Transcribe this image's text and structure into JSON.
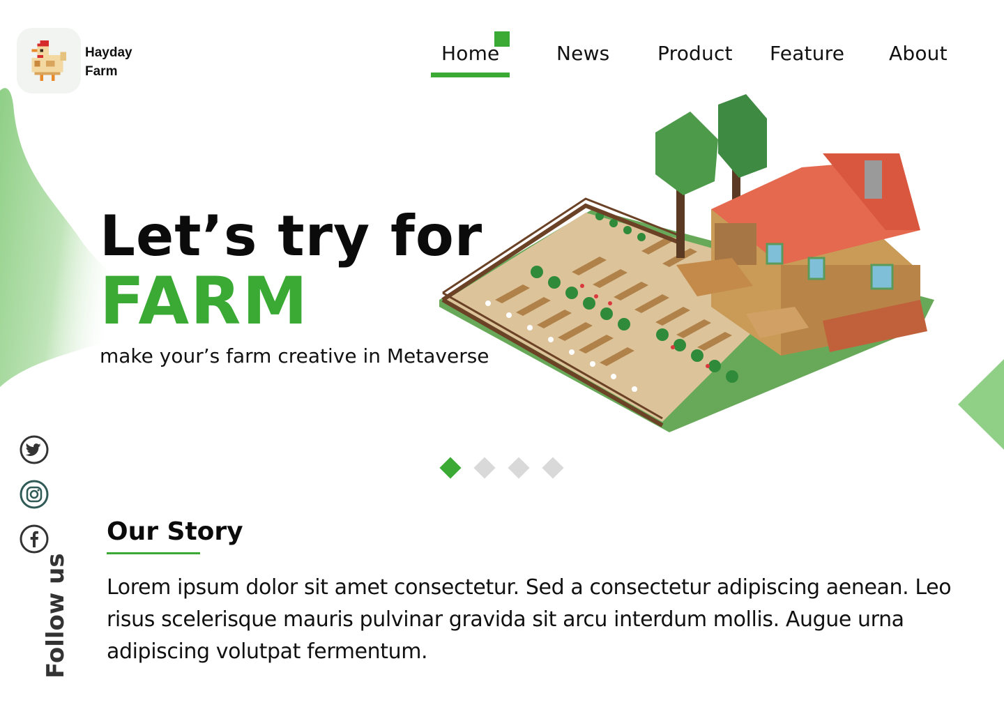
{
  "brand": {
    "name_line1": "Hayday",
    "name_line2": "Farm",
    "logo_icon": "pixel-chicken-icon"
  },
  "nav": {
    "items": [
      {
        "label": "Home",
        "active": true
      },
      {
        "label": "News"
      },
      {
        "label": "Product"
      },
      {
        "label": "Feature"
      },
      {
        "label": "About"
      }
    ]
  },
  "hero": {
    "title": "Let’s try for",
    "highlight": "FARM",
    "subtitle": "make your’s farm creative in Metaverse",
    "illustration": "isometric-farm-house-illustration"
  },
  "carousel": {
    "total": 4,
    "active_index": 0
  },
  "social": {
    "follow_label": "Follow us",
    "icons": [
      "twitter-icon",
      "instagram-icon",
      "facebook-icon"
    ]
  },
  "story": {
    "title": "Our Story",
    "body": "Lorem ipsum dolor sit amet consectetur. Sed a consectetur adipiscing aenean. Leo risus scelerisque mauris pulvinar gravida sit arcu interdum mollis. Augue urna adipiscing volutpat fermentum."
  },
  "colors": {
    "accent": "#3aaa35",
    "accent_light": "#8fcf86",
    "dot_inactive": "#d9d9d9"
  }
}
